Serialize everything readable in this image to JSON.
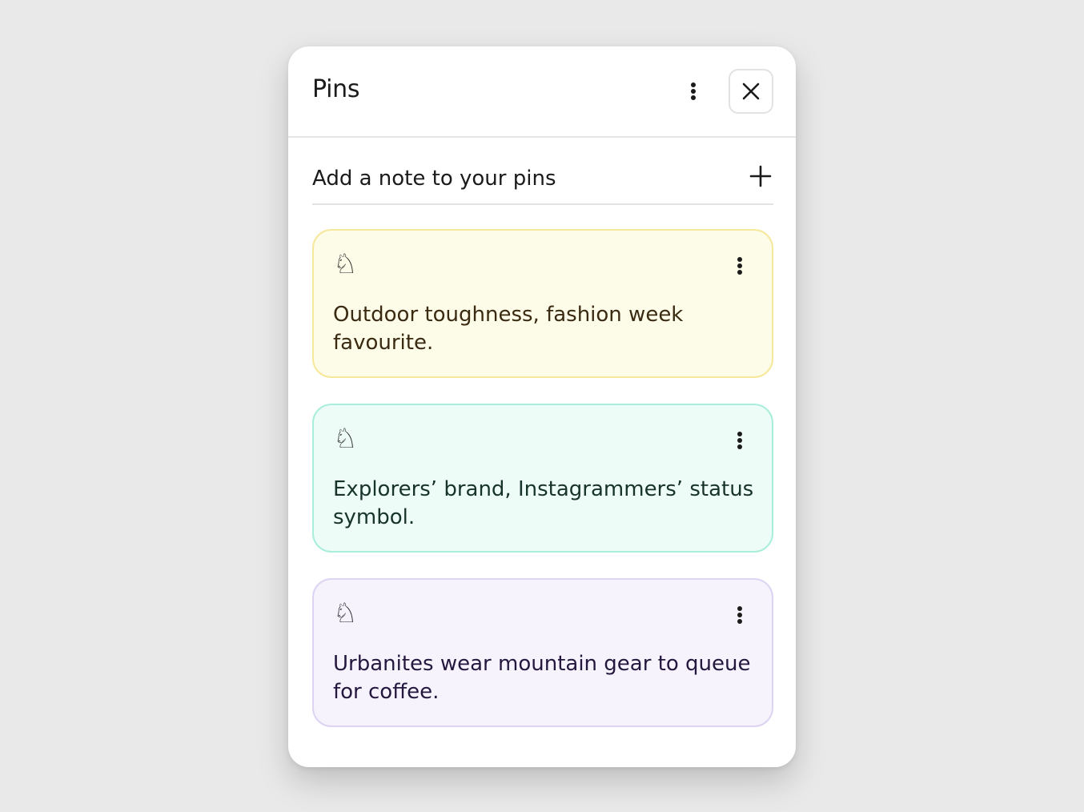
{
  "panel": {
    "title": "Pins",
    "menu_icon": "more-vertical-icon",
    "close_icon": "close-icon"
  },
  "add_note": {
    "label": "Add a note to your pins",
    "icon": "plus-icon"
  },
  "notes": [
    {
      "icon": "chess-knight-icon",
      "icon_glyph": "♘",
      "text": "Outdoor toughness, fashion week favourite.",
      "bg": "#fdfce8",
      "border": "#f6e89a",
      "text_color": "#3a2a12"
    },
    {
      "icon": "chess-knight-icon",
      "icon_glyph": "♘",
      "text": "Explorers’ brand, Instagrammers’ status symbol.",
      "bg": "#eefcf7",
      "border": "#a8eedb",
      "text_color": "#17332c"
    },
    {
      "icon": "chess-knight-icon",
      "icon_glyph": "♘",
      "text": "Urbanites wear mountain gear to queue for coffee.",
      "bg": "#f6f3fd",
      "border": "#ddd3f2",
      "text_color": "#25183f"
    }
  ]
}
